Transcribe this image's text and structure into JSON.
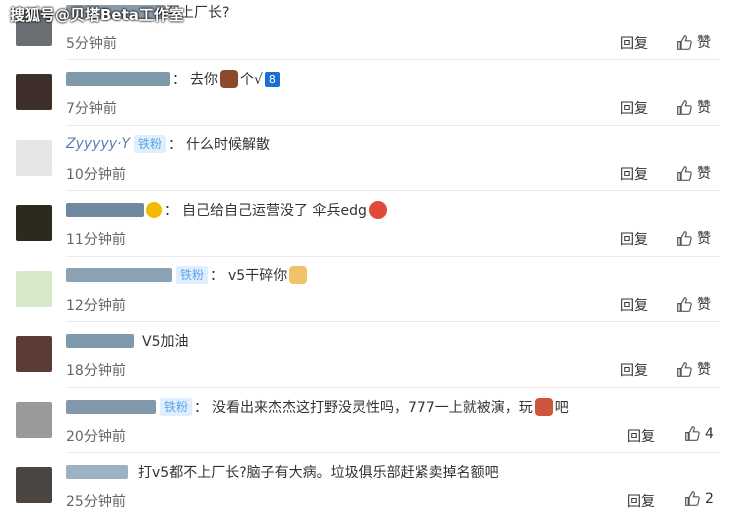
{
  "watermark": "搜狐号@贝塔Beta工作室",
  "reply_label": "回复",
  "like_label": "赞",
  "fan_badge": "铁粉",
  "comments": [
    {
      "text": "至上厂长?",
      "time": "5分钟前",
      "likes": ""
    },
    {
      "text": "去你",
      "text2": "个√",
      "badge": "8",
      "time": "7分钟前",
      "likes": ""
    },
    {
      "user": "Zyyyyy·Y",
      "fan": true,
      "text": "什么时候解散",
      "time": "10分钟前",
      "likes": ""
    },
    {
      "text": "自己给自己运营没了 伞兵edg",
      "time": "11分钟前",
      "likes": ""
    },
    {
      "fan": true,
      "text": "v5干碎你",
      "time": "12分钟前",
      "likes": ""
    },
    {
      "text": "V5加油",
      "time": "18分钟前",
      "likes": ""
    },
    {
      "fan": true,
      "text": "没看出来杰杰这打野没灵性吗，777一上就被演，玩",
      "text2": "吧",
      "time": "20分钟前",
      "likes": "4"
    },
    {
      "text": "打v5都不上厂长?脑子有大病。垃圾俱乐部赶紧卖掉名额吧",
      "time": "25分钟前",
      "likes": "2"
    }
  ]
}
